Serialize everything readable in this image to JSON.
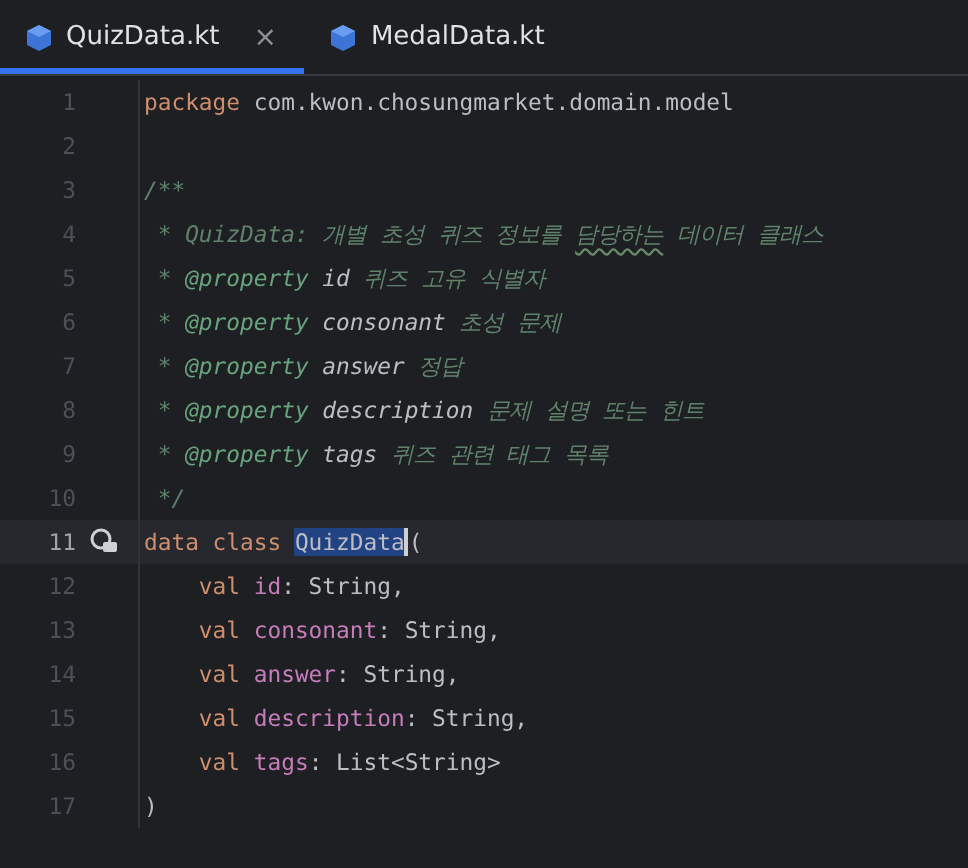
{
  "tabs": [
    {
      "label": "QuizData.kt",
      "selected": true,
      "close": "×"
    },
    {
      "label": "MedalData.kt",
      "selected": false
    }
  ],
  "lines": [
    {
      "number": "1",
      "current": false,
      "gutter_icon": false,
      "tokens": [
        {
          "kind": "keyword",
          "text": "package"
        },
        {
          "kind": "plain",
          "text": " com.kwon.chosungmarket.domain.model"
        }
      ]
    },
    {
      "number": "2",
      "current": false,
      "gutter_icon": false
    },
    {
      "number": "3",
      "current": false,
      "gutter_icon": false,
      "tokens": [
        {
          "kind": "doc",
          "text": "/**"
        }
      ]
    },
    {
      "number": "4",
      "current": false,
      "gutter_icon": false,
      "tokens": [
        {
          "kind": "doc",
          "text": " * QuizData: 개별 초성 퀴즈 정보를 "
        },
        {
          "kind": "typo",
          "text": "담당하는"
        },
        {
          "kind": "doc",
          "text": " 데이터 클래스"
        }
      ]
    },
    {
      "number": "5",
      "current": false,
      "gutter_icon": false,
      "tokens": [
        {
          "kind": "doc",
          "text": " * "
        },
        {
          "kind": "doctag",
          "text": "@property"
        },
        {
          "kind": "docparam",
          "text": " id"
        },
        {
          "kind": "doc",
          "text": " 퀴즈 고유 식별자"
        }
      ]
    },
    {
      "number": "6",
      "current": false,
      "gutter_icon": false,
      "tokens": [
        {
          "kind": "doc",
          "text": " * "
        },
        {
          "kind": "doctag",
          "text": "@property"
        },
        {
          "kind": "docparam",
          "text": " consonant"
        },
        {
          "kind": "doc",
          "text": " 초성 문제"
        }
      ]
    },
    {
      "number": "7",
      "current": false,
      "gutter_icon": false,
      "tokens": [
        {
          "kind": "doc",
          "text": " * "
        },
        {
          "kind": "doctag",
          "text": "@property"
        },
        {
          "kind": "docparam",
          "text": " answer"
        },
        {
          "kind": "doc",
          "text": " 정답"
        }
      ]
    },
    {
      "number": "8",
      "current": false,
      "gutter_icon": false,
      "tokens": [
        {
          "kind": "doc",
          "text": " * "
        },
        {
          "kind": "doctag",
          "text": "@property"
        },
        {
          "kind": "docparam",
          "text": " description"
        },
        {
          "kind": "doc",
          "text": " 문제 설명 또는 힌트"
        }
      ]
    },
    {
      "number": "9",
      "current": false,
      "gutter_icon": false,
      "tokens": [
        {
          "kind": "doc",
          "text": " * "
        },
        {
          "kind": "doctag",
          "text": "@property"
        },
        {
          "kind": "docparam",
          "text": " tags"
        },
        {
          "kind": "doc",
          "text": " 퀴즈 관련 태그 목록"
        }
      ]
    },
    {
      "number": "10",
      "current": false,
      "gutter_icon": false,
      "tokens": [
        {
          "kind": "doc",
          "text": " */"
        }
      ]
    },
    {
      "number": "11",
      "current": true,
      "gutter_icon": true,
      "tokens": [
        {
          "kind": "keyword",
          "text": "data class "
        },
        {
          "kind": "selected",
          "text": "QuizData"
        },
        {
          "kind": "plain",
          "text": "("
        }
      ]
    },
    {
      "number": "12",
      "current": false,
      "gutter_icon": false,
      "tokens": [
        {
          "kind": "keyword",
          "text": "    val "
        },
        {
          "kind": "property",
          "text": "id"
        },
        {
          "kind": "plain",
          "text": ": String,"
        }
      ]
    },
    {
      "number": "13",
      "current": false,
      "gutter_icon": false,
      "tokens": [
        {
          "kind": "keyword",
          "text": "    val "
        },
        {
          "kind": "property",
          "text": "consonant"
        },
        {
          "kind": "plain",
          "text": ": String,"
        }
      ]
    },
    {
      "number": "14",
      "current": false,
      "gutter_icon": false,
      "tokens": [
        {
          "kind": "keyword",
          "text": "    val "
        },
        {
          "kind": "property",
          "text": "answer"
        },
        {
          "kind": "plain",
          "text": ": String,"
        }
      ]
    },
    {
      "number": "15",
      "current": false,
      "gutter_icon": false,
      "tokens": [
        {
          "kind": "keyword",
          "text": "    val "
        },
        {
          "kind": "property",
          "text": "description"
        },
        {
          "kind": "plain",
          "text": ": String,"
        }
      ]
    },
    {
      "number": "16",
      "current": false,
      "gutter_icon": false,
      "tokens": [
        {
          "kind": "keyword",
          "text": "    val "
        },
        {
          "kind": "property",
          "text": "tags"
        },
        {
          "kind": "plain",
          "text": ": List<String>"
        }
      ]
    },
    {
      "number": "17",
      "current": false,
      "gutter_icon": false,
      "tokens": [
        {
          "kind": "plain",
          "text": ")"
        }
      ]
    }
  ]
}
